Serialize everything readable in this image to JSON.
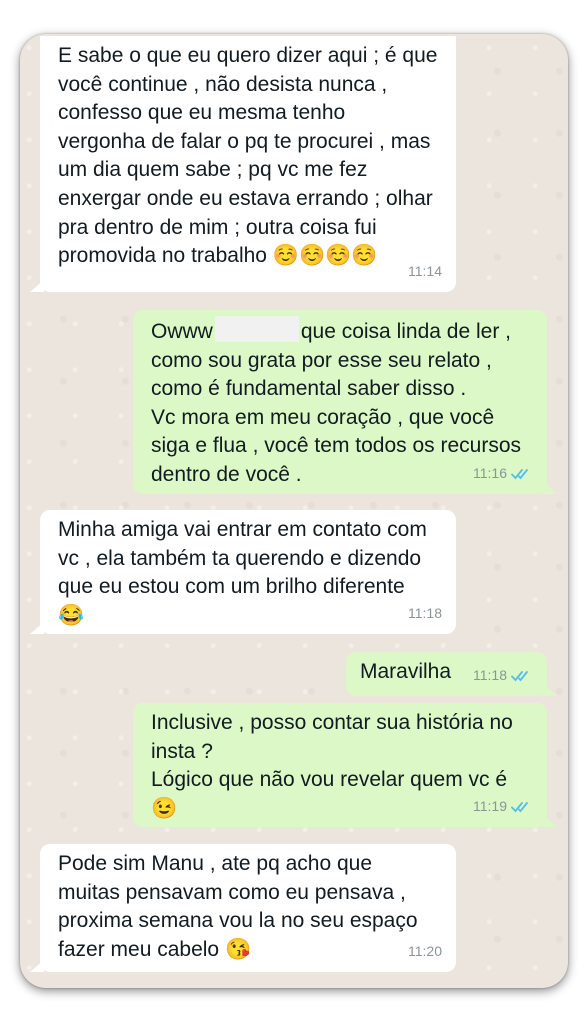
{
  "messages": [
    {
      "direction": "incoming",
      "text": "E sabe o que eu quero dizer aqui ; é que\nvocê continue , não desista nunca ,\nconfesso que eu mesma tenho\nvergonha de falar o pq te procurei , mas\num dia quem sabe ; pq vc me fez\nenxergar onde eu estava errando ; olhar\npra dentro de mim ; outra coisa fui\npromovida no trabalho",
      "emoji": "☺️☺️☺️☺️",
      "time": "11:14"
    },
    {
      "direction": "outgoing",
      "text_before_redaction": "Owww",
      "text": "que coisa linda de ler ,\ncomo sou grata por esse seu relato ,\ncomo é fundamental saber disso .\nVc mora em meu coração , que você\nsiga e flua , você tem todos os recursos\ndentro de você .",
      "time": "11:16",
      "status": "read"
    },
    {
      "direction": "incoming",
      "text": "Minha amiga vai entrar em contato com\nvc , ela também ta querendo e dizendo\nque eu estou com um brilho diferente",
      "emoji": "😂",
      "time": "11:18"
    },
    {
      "direction": "outgoing",
      "text": "Maravilha",
      "time": "11:18",
      "status": "read"
    },
    {
      "direction": "outgoing",
      "text": "Inclusive , posso contar sua história no\ninsta ?\nLógico que não vou revelar quem vc é",
      "emoji": "😉",
      "time": "11:19",
      "status": "read"
    },
    {
      "direction": "incoming",
      "text": "Pode sim Manu , ate pq acho que\nmuitas pensavam como eu pensava ,\nproxima semana vou la no seu espaço\nfazer meu cabelo",
      "emoji": "😘",
      "time": "11:20"
    }
  ],
  "colors": {
    "chat_background": "#ece5dd",
    "incoming_bubble": "#ffffff",
    "outgoing_bubble": "#dcf8c6",
    "read_ticks": "#53bdeb",
    "timestamp": "#8a949a"
  },
  "icons": {
    "read_receipt": "double-check-icon"
  }
}
